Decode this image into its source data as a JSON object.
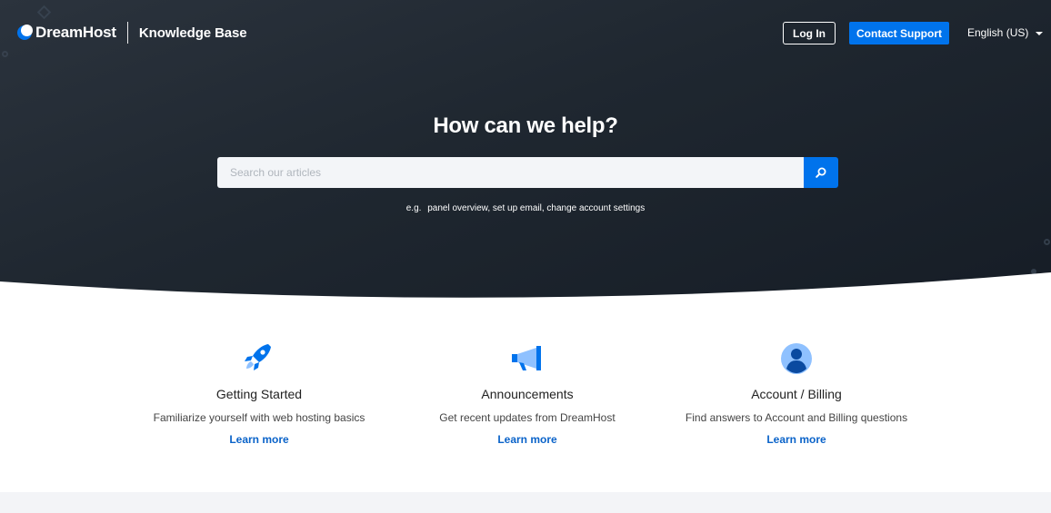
{
  "header": {
    "logo_text": "DreamHost",
    "section_title": "Knowledge Base",
    "login_label": "Log In",
    "support_label": "Contact Support",
    "language": "English (US)"
  },
  "hero": {
    "title": "How can we help?",
    "search_placeholder": "Search our articles",
    "examples_prefix": "e.g.",
    "examples": "panel overview, set up email, change account settings"
  },
  "cards": [
    {
      "icon": "rocket-icon",
      "title": "Getting Started",
      "description": "Familiarize yourself with web hosting basics",
      "link": "Learn more"
    },
    {
      "icon": "megaphone-icon",
      "title": "Announcements",
      "description": "Get recent updates from DreamHost",
      "link": "Learn more"
    },
    {
      "icon": "user-icon",
      "title": "Account / Billing",
      "description": "Find answers to Account and Billing questions",
      "link": "Learn more"
    }
  ],
  "colors": {
    "hero_background": "#1f2730",
    "accent_blue": "#0073ec",
    "link_blue": "#0a63c9",
    "icon_light_blue": "#8fc1ff"
  }
}
